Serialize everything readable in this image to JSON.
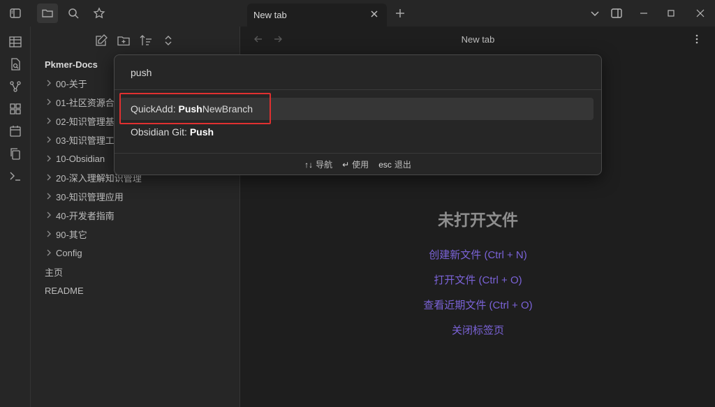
{
  "tab": {
    "title": "New tab"
  },
  "view": {
    "title": "New tab"
  },
  "sidebar": {
    "vault_name": "Pkmer-Docs",
    "items": [
      {
        "label": "00-关于",
        "folder": true
      },
      {
        "label": "01-社区资源合",
        "folder": true
      },
      {
        "label": "02-知识管理基",
        "folder": true
      },
      {
        "label": "03-知识管理工",
        "folder": true
      },
      {
        "label": "10-Obsidian",
        "folder": true
      },
      {
        "label": "20-深入理解知识管理",
        "folder": true
      },
      {
        "label": "30-知识管理应用",
        "folder": true
      },
      {
        "label": "40-开发者指南",
        "folder": true
      },
      {
        "label": "90-其它",
        "folder": true
      },
      {
        "label": "Config",
        "folder": true
      },
      {
        "label": "主页",
        "folder": false
      },
      {
        "label": "README",
        "folder": false
      }
    ]
  },
  "palette": {
    "query": "push",
    "suggestions": [
      {
        "prefix": "QuickAdd: ",
        "match": "Push",
        "suffix": "NewBranch"
      },
      {
        "prefix": "Obsidian Git: ",
        "match": "Push",
        "suffix": ""
      }
    ],
    "instructions": [
      {
        "key": "↑↓",
        "label": "导航"
      },
      {
        "key": "↵",
        "label": "使用"
      },
      {
        "key": "esc",
        "label": "退出"
      }
    ]
  },
  "empty_state": {
    "title": "未打开文件",
    "actions": [
      "创建新文件 (Ctrl + N)",
      "打开文件 (Ctrl + O)",
      "查看近期文件 (Ctrl + O)",
      "关闭标签页"
    ]
  },
  "colors": {
    "accent": "#7b63d8",
    "highlight": "#e03030"
  }
}
